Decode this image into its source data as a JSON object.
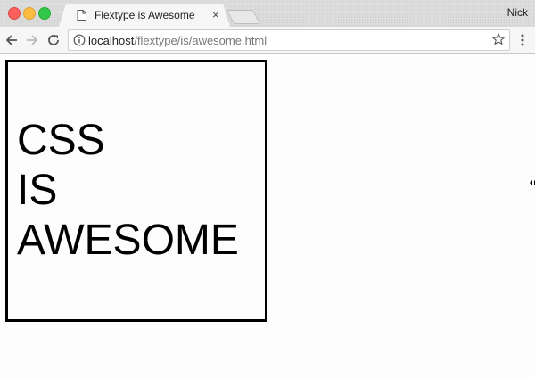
{
  "window": {
    "tab_title": "Flextype is Awesome",
    "tab_close": "×",
    "profile_name": "Nick",
    "traffic_colors": {
      "close": "#fc605c",
      "minimize": "#fdbc40",
      "maximize": "#34c84a"
    }
  },
  "toolbar": {
    "url_host": "localhost",
    "url_path": "/flextype/is/awesome.html",
    "icons": [
      "back-icon",
      "forward-icon",
      "reload-icon",
      "info-icon",
      "star-icon",
      "menu-icon"
    ]
  },
  "page": {
    "lines": [
      "CSS",
      "IS",
      "AWESOME"
    ]
  }
}
